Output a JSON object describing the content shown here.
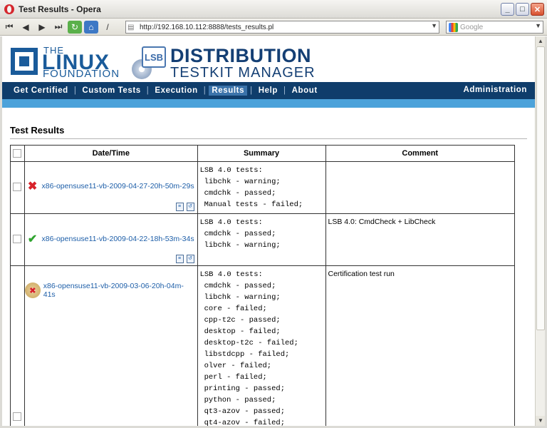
{
  "window": {
    "title": "Test Results - Opera",
    "min_label": "_",
    "max_label": "□",
    "close_label": "✕"
  },
  "toolbar": {
    "url": "http://192.168.10.112:8888/tests_results.pl",
    "search_placeholder": "Google"
  },
  "header": {
    "lf_the": "THE",
    "lf_linux": "LINUX",
    "lf_foundation": "FOUNDATION",
    "lsb": "LSB",
    "dtm_line1": "DISTRIBUTION",
    "dtm_line2": "TESTKIT MANAGER"
  },
  "nav": {
    "items": [
      "Get Certified",
      "Custom Tests",
      "Execution",
      "Results",
      "Help",
      "About"
    ],
    "active": "Results",
    "admin": "Administration"
  },
  "content": {
    "heading": "Test Results",
    "columns": [
      "Date/Time",
      "Summary",
      "Comment"
    ],
    "rows": [
      {
        "status": "failed",
        "run": "x86-opensuse11-vb-2009-04-27-20h-50m-29s",
        "summary_title": "LSB 4.0 tests:",
        "summary_items": [
          "libchk - warning;",
          "cmdchk - passed;",
          "Manual tests - failed;"
        ],
        "comment": ""
      },
      {
        "status": "passed",
        "run": "x86-opensuse11-vb-2009-04-22-18h-53m-34s",
        "summary_title": "LSB 4.0 tests:",
        "summary_items": [
          "cmdchk - passed;",
          "libchk - warning;"
        ],
        "comment": "LSB 4.0: CmdCheck + LibCheck"
      },
      {
        "status": "certification",
        "run": "x86-opensuse11-vb-2009-03-06-20h-04m-41s",
        "summary_title": "LSB 4.0 tests:",
        "summary_items": [
          "cmdchk - passed;",
          "libchk - warning;",
          "core - failed;",
          "cpp-t2c - passed;",
          "desktop - failed;",
          "desktop-t2c - failed;",
          "libstdcpp - failed;",
          "olver - failed;",
          "perl - failed;",
          "printing - passed;",
          "python - passed;",
          "qt3-azov - passed;",
          "qt4-azov - failed;"
        ],
        "comment": "Certification test run"
      }
    ]
  }
}
